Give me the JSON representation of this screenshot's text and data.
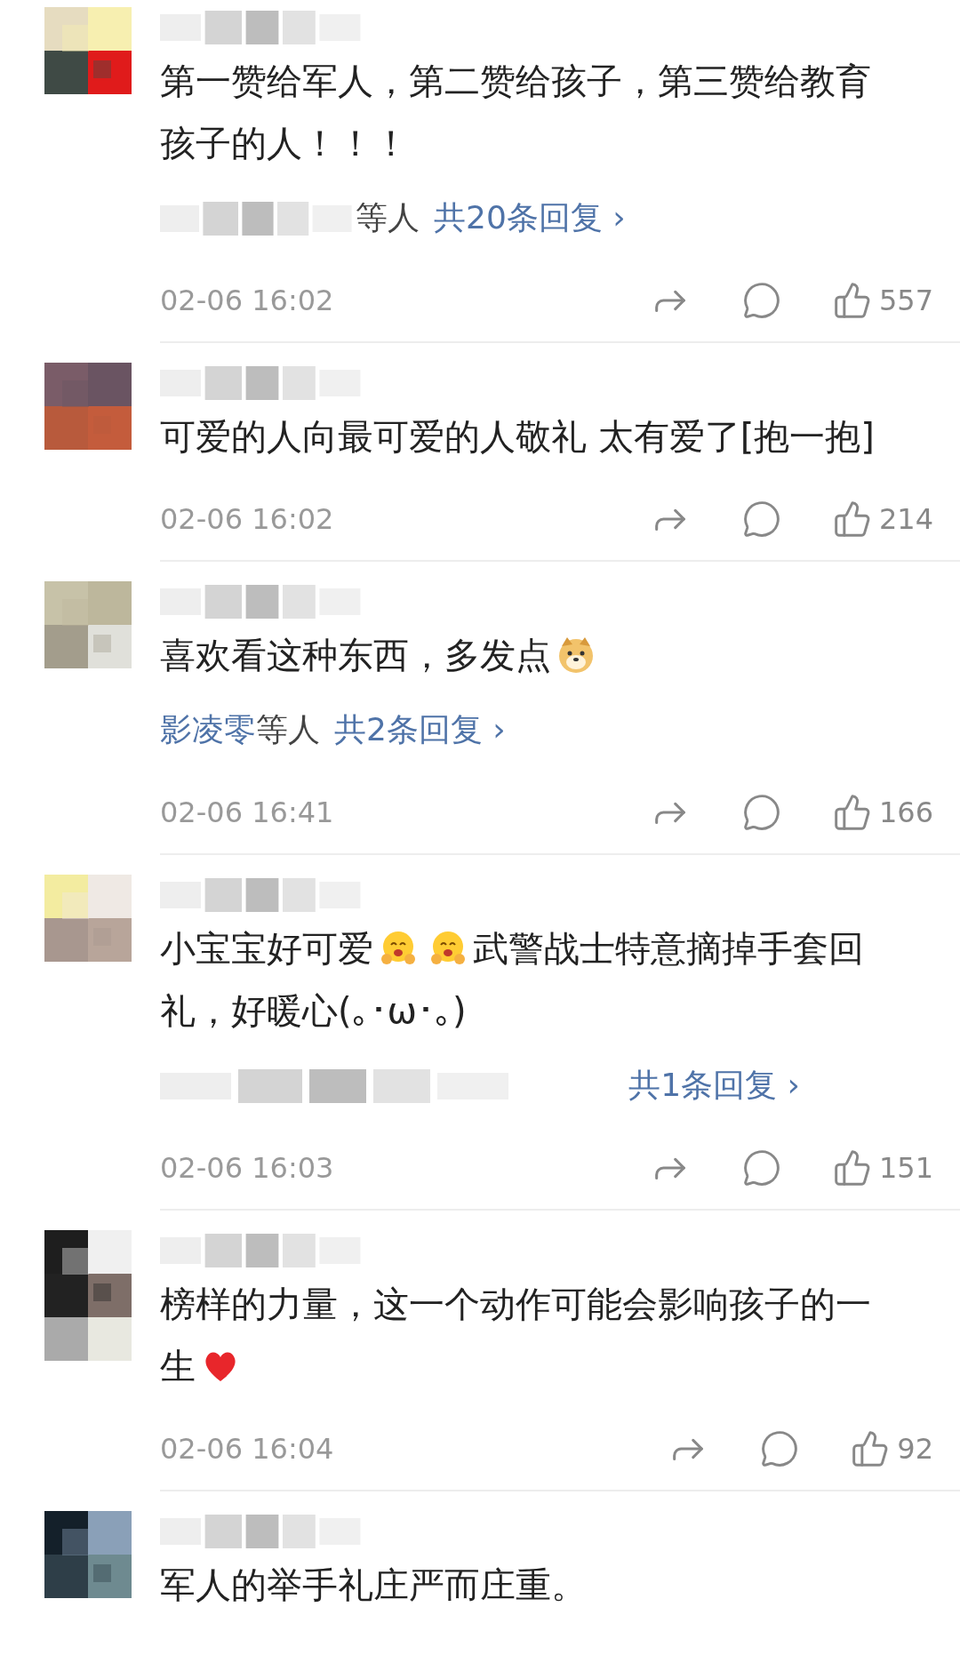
{
  "comments": [
    {
      "avatar": {
        "kind": "picture"
      },
      "segments": [
        {
          "kind": "text",
          "text": "第一赞给军人，第二赞给孩子，第三赞给教育孩子的人！！！"
        }
      ],
      "reply": {
        "suffix": "等人",
        "count": "共20条回复",
        "arrow": "›"
      },
      "time": "02-06 16:02",
      "likes": "557"
    },
    {
      "avatar": {
        "kind": "picture"
      },
      "segments": [
        {
          "kind": "text",
          "text": "可爱的人向最可爱的人敬礼 太有爱了[抱一抱]"
        }
      ],
      "time": "02-06 16:02",
      "likes": "214"
    },
    {
      "avatar": {
        "kind": "picture"
      },
      "segments": [
        {
          "kind": "text",
          "text": "喜欢看这种东西，多发点"
        },
        {
          "kind": "doge"
        }
      ],
      "reply": {
        "names": "影凌零",
        "suffix": "等人",
        "count": "共2条回复",
        "arrow": "›"
      },
      "time": "02-06 16:41",
      "likes": "166"
    },
    {
      "avatar": {
        "kind": "picture"
      },
      "segments": [
        {
          "kind": "text",
          "text": "小宝宝好可爱"
        },
        {
          "kind": "hug"
        },
        {
          "kind": "hug"
        },
        {
          "kind": "text",
          "text": "武警战士特意摘掉手套回礼，好暖心(｡･ω･｡)"
        }
      ],
      "reply": {
        "count": "共1条回复",
        "arrow": "›"
      },
      "time": "02-06 16:03",
      "likes": "151"
    },
    {
      "avatar": {
        "kind": "picture"
      },
      "segments": [
        {
          "kind": "text",
          "text": "榜样的力量，这一个动作可能会影响孩子的一生"
        },
        {
          "kind": "heart"
        }
      ],
      "time": "02-06 16:04",
      "likes": "92"
    },
    {
      "avatar": {
        "kind": "picture"
      },
      "segments": [
        {
          "kind": "text",
          "text": "军人的举手礼庄严而庄重。"
        }
      ]
    }
  ]
}
